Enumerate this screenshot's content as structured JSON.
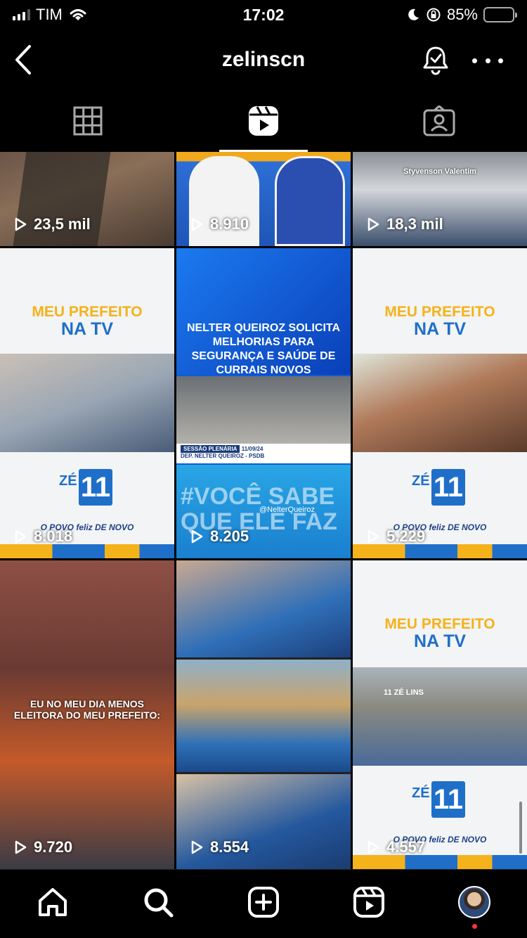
{
  "status_bar": {
    "carrier": "TIM",
    "time": "17:02",
    "battery_percent": "85%",
    "battery_level": 0.85
  },
  "header": {
    "username": "zelinscn"
  },
  "tabs": [
    {
      "icon": "grid-icon",
      "active": false
    },
    {
      "icon": "reels-icon",
      "active": true
    },
    {
      "icon": "tagged-icon",
      "active": false
    }
  ],
  "reels": [
    {
      "views": "23,5 mil"
    },
    {
      "views": "8.910"
    },
    {
      "views": "18,3 mil",
      "overlay_text": "Styvenson Valentim"
    },
    {
      "views": "8.018",
      "title_top": "MEU PREFEITO",
      "title_bottom": "NA TV",
      "logo_ze": "ZÉ",
      "logo_number": "11",
      "slogan": "O POVO feliz DE NOVO"
    },
    {
      "views": "8.205",
      "headline": "NELTER QUEIROZ SOLICITA MELHORIAS PARA SEGURANÇA E SAÚDE DE CURRAIS NOVOS",
      "lower_third_1": "SESSÃO PLENÁRIA",
      "lower_third_date": "11/09/24",
      "lower_third_2": "DEP. NELTER QUEIROZ - PSDB",
      "overlay_big": "#VOCÊ SABE QUE ELE FAZ",
      "handle": "@NelterQueiroz"
    },
    {
      "views": "5.229",
      "title_top": "MEU PREFEITO",
      "title_bottom": "NA TV",
      "logo_ze": "ZÉ",
      "logo_number": "11",
      "slogan": "O POVO feliz DE NOVO"
    },
    {
      "views": "9.720",
      "caption": "EU NO MEU DIA MENOS ELEITORA DO MEU PREFEITO:"
    },
    {
      "views": "8.554"
    },
    {
      "views": "4.557",
      "title_top": "MEU PREFEITO",
      "title_bottom": "NA TV",
      "logo_ze": "ZÉ",
      "logo_number": "11",
      "slogan": "O POVO feliz DE NOVO",
      "tag": "11 ZÉ LINS"
    }
  ],
  "bottom_nav": [
    {
      "icon": "home-icon"
    },
    {
      "icon": "search-icon"
    },
    {
      "icon": "create-icon"
    },
    {
      "icon": "reels-icon"
    },
    {
      "icon": "profile-avatar",
      "notification": true
    }
  ],
  "colors": {
    "background": "#000000",
    "accent_yellow": "#f4b21b",
    "accent_blue": "#1f6fc9",
    "notification": "#ff3040",
    "battery": "#4cd964"
  }
}
